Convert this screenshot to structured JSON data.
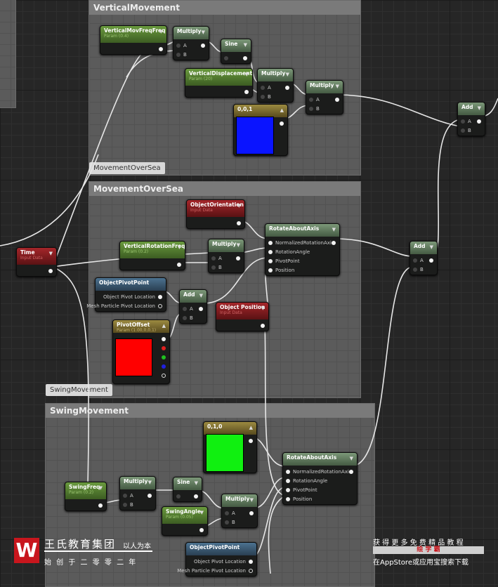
{
  "comments": [
    {
      "id": "vm",
      "title": "VerticalMovement"
    },
    {
      "id": "mos",
      "title": "MovementOverSea",
      "bubble": "MovementOverSea"
    },
    {
      "id": "sw",
      "title": "SwingMovement",
      "bubble": "SwingMovement"
    }
  ],
  "nodes": [
    {
      "id": "vmff",
      "kind": "param",
      "title": "VerticalMovFreqFreq",
      "subtitle": "Param (0.4)",
      "outputs": [
        ""
      ]
    },
    {
      "id": "mul1",
      "kind": "func",
      "title": "Multiply",
      "inputs": [
        "A",
        "B"
      ],
      "outputs": [
        ""
      ]
    },
    {
      "id": "sine1",
      "kind": "func",
      "title": "Sine",
      "inputs": [
        ""
      ],
      "outputs": [
        ""
      ]
    },
    {
      "id": "vdisp",
      "kind": "param",
      "title": "VerticalDisplacement",
      "subtitle": "Param (20)",
      "outputs": [
        ""
      ]
    },
    {
      "id": "mul2",
      "kind": "func",
      "title": "Multiply",
      "inputs": [
        "A",
        "B"
      ],
      "outputs": [
        ""
      ]
    },
    {
      "id": "mul3",
      "kind": "func",
      "title": "Multiply",
      "inputs": [
        "A",
        "B"
      ],
      "outputs": [
        ""
      ]
    },
    {
      "id": "c001",
      "kind": "const",
      "title": "0,0,1",
      "collapse": "up",
      "outputs": [
        ""
      ],
      "swatch": "#0a14ff"
    },
    {
      "id": "addtop",
      "kind": "func",
      "title": "Add",
      "inputs": [
        "A",
        "B"
      ],
      "outputs": [
        ""
      ]
    },
    {
      "id": "objor",
      "kind": "input",
      "title": "ObjectOrientation",
      "subtitle": "Input Data",
      "outputs": [
        ""
      ]
    },
    {
      "id": "raa1",
      "kind": "func",
      "title": "RotateAboutAxis",
      "inputs": [
        "NormalizedRotationAxis",
        "RotationAngle",
        "PivotPoint",
        "Position"
      ],
      "outputs": [
        ""
      ],
      "lit": true
    },
    {
      "id": "vrf",
      "kind": "param",
      "title": "VerticalRotationFreq",
      "subtitle": "Param (0.2)",
      "outputs": [
        ""
      ]
    },
    {
      "id": "mul4",
      "kind": "func",
      "title": "Multiply",
      "inputs": [
        "A",
        "B"
      ],
      "outputs": [
        ""
      ]
    },
    {
      "id": "time",
      "kind": "input",
      "title": "Time",
      "subtitle": "Input Data",
      "outputs": [
        ""
      ]
    },
    {
      "id": "opp1",
      "kind": "pivot",
      "title": "ObjectPivotPoint",
      "noarrow": true,
      "outputs": [
        "Object Pivot Location",
        "Mesh Particle Pivot Location"
      ]
    },
    {
      "id": "add2",
      "kind": "func",
      "title": "Add",
      "inputs": [
        "A",
        "B"
      ],
      "outputs": [
        ""
      ]
    },
    {
      "id": "objpos",
      "kind": "input",
      "title": "Object Position",
      "subtitle": "Input Data",
      "outputs": [
        ""
      ]
    },
    {
      "id": "pivoff",
      "kind": "const",
      "title": "PivotOffset",
      "subtitle": "Param (1.00,0,0,1)",
      "collapse": "up",
      "outputs": [
        "",
        "",
        "",
        "",
        ""
      ],
      "swatch": "#ff0000"
    },
    {
      "id": "addr",
      "kind": "func",
      "title": "Add",
      "inputs": [
        "A",
        "B"
      ],
      "outputs": [
        ""
      ]
    },
    {
      "id": "swf",
      "kind": "param",
      "title": "SwingFreq",
      "subtitle": "Param (0.2)",
      "outputs": [
        ""
      ]
    },
    {
      "id": "mul5",
      "kind": "func",
      "title": "Multiply",
      "inputs": [
        "A",
        "B"
      ],
      "outputs": [
        ""
      ]
    },
    {
      "id": "sine2",
      "kind": "func",
      "title": "Sine",
      "inputs": [
        ""
      ],
      "outputs": [
        ""
      ]
    },
    {
      "id": "swa",
      "kind": "param",
      "title": "SwingAngle",
      "subtitle": "Param (0.05)",
      "outputs": [
        ""
      ]
    },
    {
      "id": "mul6",
      "kind": "func",
      "title": "Multiply",
      "inputs": [
        "A",
        "B"
      ],
      "outputs": [
        ""
      ]
    },
    {
      "id": "c010",
      "kind": "const",
      "title": "0,1,0",
      "collapse": "up",
      "outputs": [
        ""
      ],
      "swatch": "#10f010"
    },
    {
      "id": "raa2",
      "kind": "func",
      "title": "RotateAboutAxis",
      "inputs": [
        "NormalizedRotationAxis",
        "RotationAngle",
        "PivotPoint",
        "Position"
      ],
      "outputs": [
        ""
      ],
      "lit": true
    },
    {
      "id": "opp2",
      "kind": "pivot",
      "title": "ObjectPivotPoint",
      "noarrow": true,
      "outputs": [
        "Object Pivot Location",
        "Mesh Particle Pivot Location"
      ]
    }
  ],
  "watermark": {
    "logo_letter": "W",
    "org": "王氏教育集团",
    "motto": "以人为本",
    "since": "始 创 于 二 零 零 二 年",
    "promo_line1": "获 得 更 多 免 费 精 品 教 程",
    "promo_brand": "绘 学 霸",
    "promo_line3": "在AppStore或应用宝搜索下载",
    "brand_color": "#c8161d"
  }
}
